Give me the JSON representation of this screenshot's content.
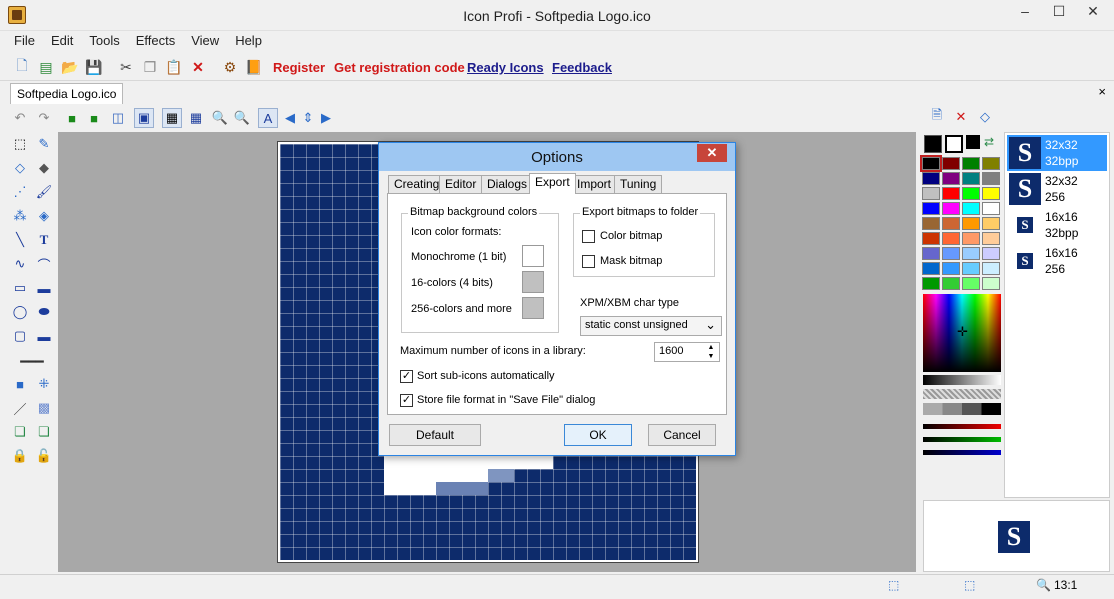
{
  "window": {
    "title": "Icon Profi - Softpedia Logo.ico",
    "minimize": "–",
    "maximize": "☐",
    "close": "✕"
  },
  "menu": [
    "File",
    "Edit",
    "Tools",
    "Effects",
    "View",
    "Help"
  ],
  "toolbar": {
    "links": [
      {
        "label": "Register",
        "color": "#d01818"
      },
      {
        "label": "Get registration code",
        "color": "#d01818"
      },
      {
        "label": "Ready Icons",
        "color": "#1c1c8c"
      },
      {
        "label": "Feedback",
        "color": "#1c1c8c"
      }
    ]
  },
  "document_tab": {
    "label": "Softpedia Logo.ico",
    "close": "×"
  },
  "dialog": {
    "title": "Options",
    "close": "✕",
    "tabs": [
      "Creating",
      "Editor",
      "Dialogs",
      "Export",
      "Import",
      "Tuning"
    ],
    "active_tab": "Export",
    "bitmap_group": {
      "label": "Bitmap background colors",
      "sub_label": "Icon color formats:",
      "rows": [
        {
          "label": "Monochrome (1 bit)",
          "color": "#ffffff"
        },
        {
          "label": "16-colors (4 bits)",
          "color": "#c0c0c0"
        },
        {
          "label": "256-colors and more",
          "color": "#c0c0c0"
        }
      ]
    },
    "export_group": {
      "label": "Export bitmaps to folder",
      "color_bitmap": {
        "label": "Color bitmap",
        "checked": false
      },
      "mask_bitmap": {
        "label": "Mask bitmap",
        "checked": false
      }
    },
    "xpm": {
      "label": "XPM/XBM char type",
      "value": "static const unsigned"
    },
    "max_icons": {
      "label": "Maximum number of icons in a library:",
      "value": "1600"
    },
    "sort_subicons": {
      "label": "Sort sub-icons automatically",
      "checked": true
    },
    "store_format": {
      "label": "Store file format in \"Save File\" dialog",
      "checked": true
    },
    "buttons": {
      "default": "Default",
      "ok": "OK",
      "cancel": "Cancel"
    }
  },
  "sizes": [
    {
      "size": "32x32",
      "depth": "32bpp",
      "selected": true
    },
    {
      "size": "32x32",
      "depth": "256",
      "selected": false
    },
    {
      "size": "16x16",
      "depth": "32bpp",
      "selected": false
    },
    {
      "size": "16x16",
      "depth": "256",
      "selected": false
    }
  ],
  "icon_letter": "S",
  "status": {
    "zoom": "13:1"
  },
  "palette": {
    "columns": [
      [
        "#000000",
        "#000080",
        "#c0c0c0",
        "#0000ff",
        "#996633",
        "#cc3300",
        "#6666cc",
        "#0066cc",
        "#009900"
      ],
      [
        "#800000",
        "#800080",
        "#ff0000",
        "#ff00ff",
        "#cc6633",
        "#ff6633",
        "#6699ff",
        "#3399ff",
        "#33cc33"
      ],
      [
        "#008000",
        "#008080",
        "#00ff00",
        "#00ffff",
        "#ff9900",
        "#ff9966",
        "#99ccff",
        "#66ccff",
        "#66ff66"
      ],
      [
        "#808000",
        "#808080",
        "#ffff00",
        "#ffffff",
        "#ffcc66",
        "#ffcc99",
        "#ccccff",
        "#cceeff",
        "#ccffcc"
      ]
    ]
  },
  "colors": {
    "canvas_bg": "#0d2b6b",
    "accent": "#3399ff"
  }
}
